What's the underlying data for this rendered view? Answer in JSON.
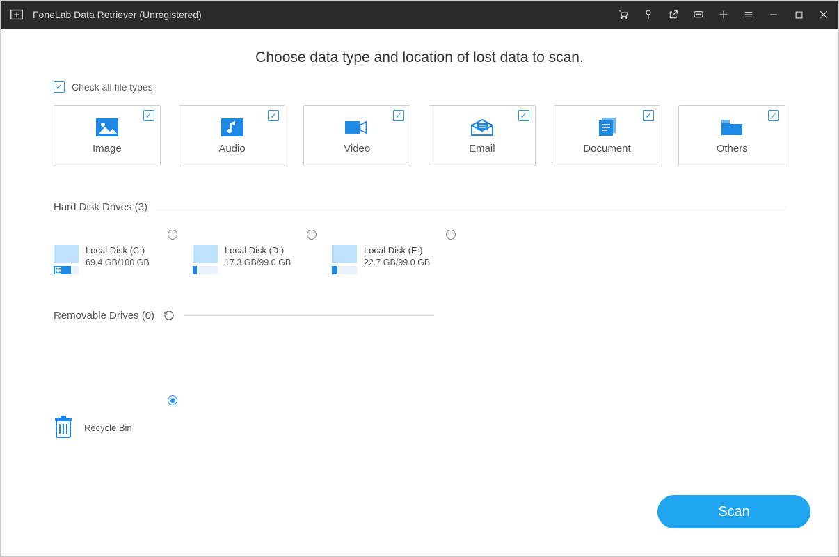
{
  "titlebar": {
    "title": "FoneLab Data Retriever (Unregistered)"
  },
  "heading": "Choose data type and location of lost data to scan.",
  "check_all_label": "Check all file types",
  "types": [
    {
      "label": "Image"
    },
    {
      "label": "Audio"
    },
    {
      "label": "Video"
    },
    {
      "label": "Email"
    },
    {
      "label": "Document"
    },
    {
      "label": "Others"
    }
  ],
  "sections": {
    "hard_disk_label": "Hard Disk Drives (3)",
    "removable_label": "Removable Drives (0)"
  },
  "drives": [
    {
      "name": "Local Disk (C:)",
      "size": "69.4 GB/100 GB",
      "fill_pct": 69,
      "is_system": true
    },
    {
      "name": "Local Disk (D:)",
      "size": "17.3 GB/99.0 GB",
      "fill_pct": 17,
      "is_system": false
    },
    {
      "name": "Local Disk (E:)",
      "size": "22.7 GB/99.0 GB",
      "fill_pct": 23,
      "is_system": false
    }
  ],
  "recycle": {
    "label": "Recycle Bin",
    "selected": true
  },
  "scan_label": "Scan"
}
